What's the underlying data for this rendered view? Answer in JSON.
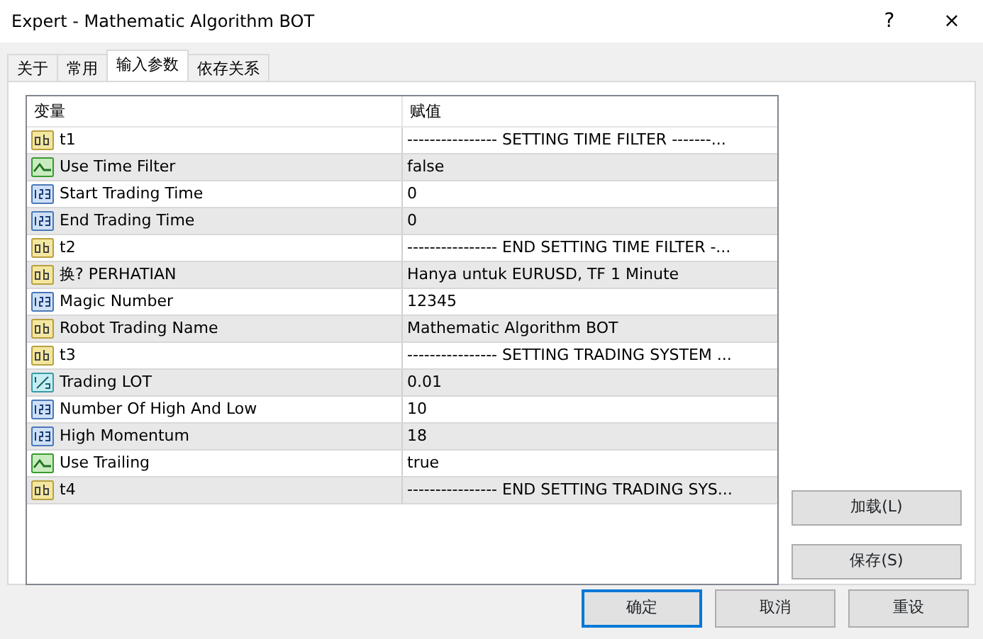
{
  "window": {
    "title": "Expert - Mathematic Algorithm BOT",
    "help": "?",
    "close": "×"
  },
  "tabs": [
    {
      "label": "关于",
      "selected": false
    },
    {
      "label": "常用",
      "selected": false
    },
    {
      "label": "输入参数",
      "selected": true
    },
    {
      "label": "依存关系",
      "selected": false
    }
  ],
  "table": {
    "columns": [
      "变量",
      "赋值"
    ],
    "rows": [
      {
        "kind": "string",
        "name": "t1",
        "value": "---------------- SETTING TIME FILTER -------..."
      },
      {
        "kind": "bool",
        "name": "Use Time Filter",
        "value": "false"
      },
      {
        "kind": "int",
        "name": "Start Trading Time",
        "value": "0"
      },
      {
        "kind": "int",
        "name": "End Trading Time",
        "value": "0"
      },
      {
        "kind": "string",
        "name": "t2",
        "value": "---------------- END SETTING TIME FILTER -..."
      },
      {
        "kind": "string",
        "name": "换? PERHATIAN",
        "value": "Hanya untuk EURUSD, TF 1 Minute"
      },
      {
        "kind": "int",
        "name": "Magic Number",
        "value": "12345"
      },
      {
        "kind": "string",
        "name": "Robot Trading Name",
        "value": "Mathematic Algorithm BOT"
      },
      {
        "kind": "string",
        "name": "t3",
        "value": "---------------- SETTING TRADING SYSTEM ..."
      },
      {
        "kind": "double",
        "name": "Trading LOT",
        "value": "0.01"
      },
      {
        "kind": "int",
        "name": "Number Of High And Low",
        "value": "10"
      },
      {
        "kind": "int",
        "name": "High Momentum",
        "value": "18"
      },
      {
        "kind": "bool",
        "name": "Use Trailing",
        "value": "true"
      },
      {
        "kind": "string",
        "name": "t4",
        "value": "---------------- END SETTING TRADING SYS..."
      }
    ]
  },
  "side_buttons": [
    "加载(L)",
    "保存(S)"
  ],
  "buttons": [
    {
      "label": "确定",
      "default": true
    },
    {
      "label": "取消",
      "default": false
    },
    {
      "label": "重设",
      "default": false
    }
  ]
}
